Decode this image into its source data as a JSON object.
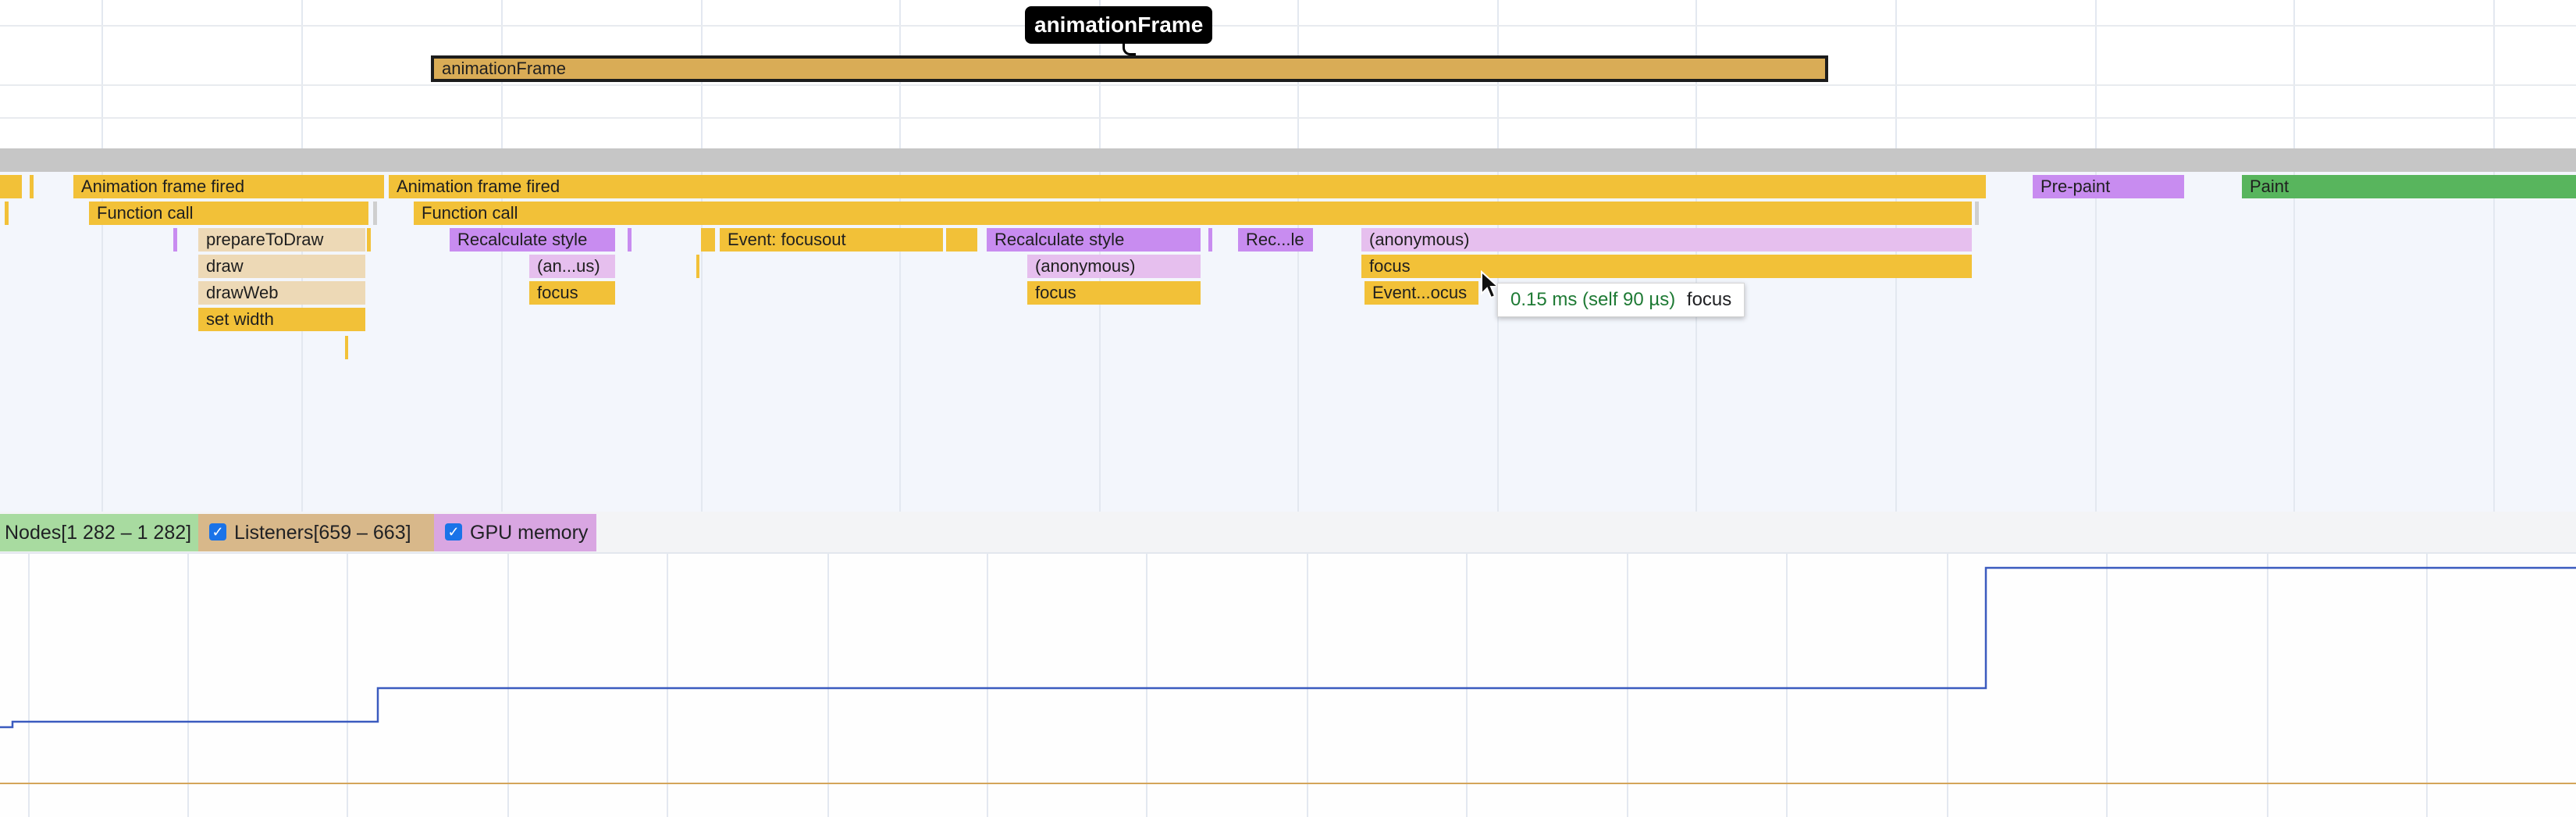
{
  "marker": {
    "tooltip": "animationFrame",
    "bar_label": "animationFrame"
  },
  "flame": {
    "row0": {
      "left": "Animation frame fired",
      "right": "Animation frame fired",
      "prepaint": "Pre-paint",
      "paint": "Paint"
    },
    "row1": {
      "left": "Function call",
      "right": "Function call"
    },
    "row2": {
      "a": "prepareToDraw",
      "b": "Recalculate style",
      "c": "Event: focusout",
      "d": "Recalculate style",
      "e": "Rec...le",
      "f": "(anonymous)"
    },
    "row3": {
      "a": "draw",
      "b": "(an...us)",
      "c": "(anonymous)",
      "d": "focus"
    },
    "row4": {
      "a": "drawWeb",
      "b": "focus",
      "c": "focus",
      "d": "Event...ocus"
    },
    "row5": {
      "a": "set width"
    }
  },
  "hover_tooltip": {
    "time": "0.15 ms (self 90 µs)",
    "name": "focus"
  },
  "counters": {
    "nodes": "Nodes[1 282 – 1 282]",
    "listeners": "Listeners[659 – 663]",
    "gpu": "GPU memory"
  },
  "colors": {
    "scripting": "#f2c138",
    "rendering": "#c88cf0",
    "painting": "#58b55d",
    "nodes_chip": "#a8dba0",
    "listeners_chip": "#d8b88a",
    "gpu_chip": "#d9a6e2",
    "graph_line": "#3b5bbf"
  },
  "icons": {
    "checkbox": "checkmark-icon",
    "cursor": "mouse-pointer-icon"
  }
}
